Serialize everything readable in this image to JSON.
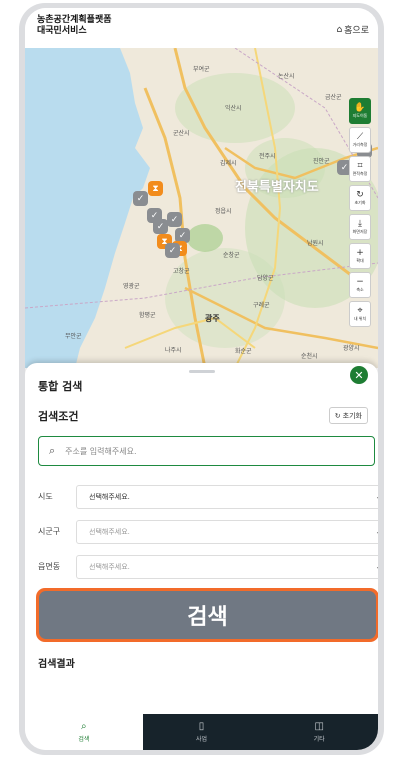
{
  "header": {
    "title_line1": "농촌공간계획플랫폼",
    "title_line2": "대국민서비스",
    "home_label": "홈으로",
    "home_icon": "home-icon"
  },
  "map": {
    "labels": {
      "buyeo": "부여군",
      "nonsan": "논산시",
      "iksan": "익산시",
      "gunsan": "군산시",
      "gimje": "김제시",
      "jeonju": "전주시",
      "jinan": "진안군",
      "jeonbuk": "전북특별자치도",
      "jeongeup": "정읍시",
      "namwon": "남원시",
      "gochang": "고창군",
      "sunchang": "순창군",
      "damyang": "담양군",
      "gwangju": "광주",
      "hwasun": "화순군",
      "suncheon": "순천시",
      "gwangyang": "광양시",
      "yeonggwang": "영광군",
      "hampyeong": "함평군",
      "naju": "나주시",
      "gurye": "구례군",
      "geumsan": "금산군",
      "muan": "무안군"
    },
    "marker_icons": {
      "gray": "check-icon",
      "orange": "hourglass-icon"
    }
  },
  "toolbar": {
    "items": [
      {
        "label": "지도이동",
        "icon": "hand-icon"
      },
      {
        "label": "거리측정",
        "icon": "ruler-icon"
      },
      {
        "label": "면적측정",
        "icon": "area-icon"
      },
      {
        "label": "초기화",
        "icon": "refresh-icon"
      },
      {
        "label": "화면저장",
        "icon": "download-icon"
      },
      {
        "label": "확대",
        "icon": "plus-icon"
      },
      {
        "label": "축소",
        "icon": "minus-icon"
      },
      {
        "label": "내 위치",
        "icon": "location-icon"
      }
    ]
  },
  "panel": {
    "title": "통합 검색",
    "conditions_title": "검색조건",
    "reset_label": "초기화",
    "search_placeholder": "주소를 입력해주세요.",
    "filters": [
      {
        "label": "시도",
        "value": "선택해주세요."
      },
      {
        "label": "시군구",
        "value": "선택해주세요."
      },
      {
        "label": "읍면동",
        "value": "선택해주세요."
      }
    ],
    "search_button": "검색",
    "results_title": "검색결과"
  },
  "bottom_nav": [
    {
      "label": "검색",
      "icon": "search-icon"
    },
    {
      "label": "사업",
      "icon": "clipboard-icon"
    },
    {
      "label": "기타",
      "icon": "map-icon"
    }
  ],
  "colors": {
    "accent": "#1e7d33",
    "highlight": "#f26b2a",
    "button": "#707883",
    "nav_dark": "#17232b"
  }
}
